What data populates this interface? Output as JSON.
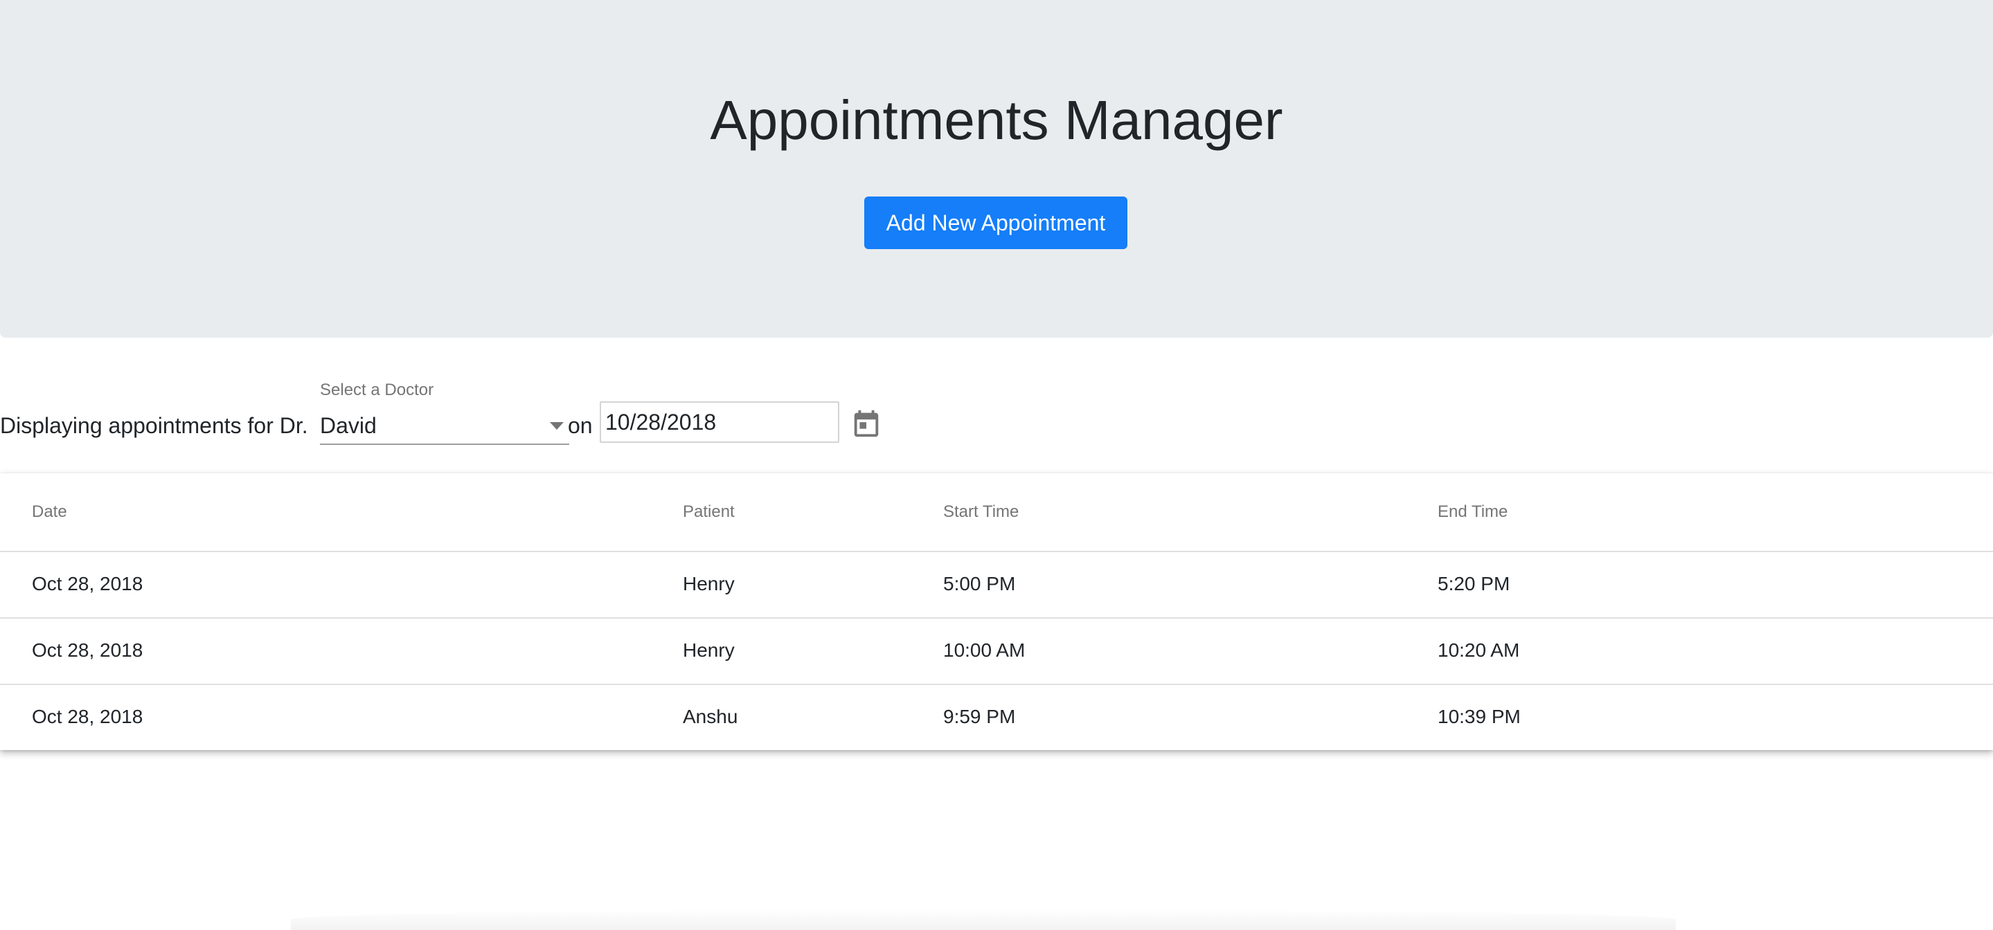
{
  "header": {
    "title": "Appointments Manager",
    "add_button_label": "Add New Appointment"
  },
  "filter": {
    "prefix": "Displaying appointments for Dr.",
    "doctor_select_label": "Select a Doctor",
    "doctor_selected": "David",
    "on_text": "on",
    "date_value": "10/28/2018"
  },
  "table": {
    "headers": [
      "Date",
      "Patient",
      "Start Time",
      "End Time"
    ],
    "rows": [
      [
        "Oct 28, 2018",
        "Henry",
        "5:00 PM",
        "5:20 PM"
      ],
      [
        "Oct 28, 2018",
        "Henry",
        "10:00 AM",
        "10:20 AM"
      ],
      [
        "Oct 28, 2018",
        "Anshu",
        "9:59 PM",
        "10:39 PM"
      ]
    ]
  },
  "colors": {
    "primary": "#157ef8",
    "hero_bg": "#e9ecef",
    "muted_text": "#757575"
  },
  "icons": {
    "calendar": "calendar-icon",
    "dropdown": "chevron-down-icon"
  }
}
